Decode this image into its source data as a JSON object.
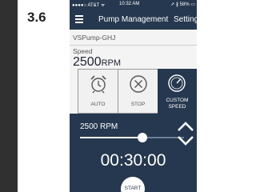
{
  "step": {
    "number": "3.6"
  },
  "status_bar": {
    "carrier": "●●●●○ AT&T ᯤ",
    "time": "10:32 AM",
    "battery": "➚ ∦ 58% ▭"
  },
  "nav": {
    "menu_icon": "hamburger-icon",
    "title": "Pump Management",
    "setting": "Setting"
  },
  "pump": {
    "name": "VSPump-GHJ"
  },
  "speed": {
    "label": "Speed",
    "value": "2500",
    "unit": "RPM"
  },
  "modes": [
    {
      "label": "AUTO",
      "icon": "alarm-clock-icon",
      "selected": false
    },
    {
      "label": "STOP",
      "icon": "stop-x-icon",
      "selected": false
    },
    {
      "label_line1": "CUSTOM",
      "label_line2": "SPEED",
      "icon": "gauge-icon",
      "selected": true
    }
  ],
  "custom": {
    "rpm_label": "2500 RPM",
    "slider_fraction": 0.6,
    "timer": "00:30:00",
    "start_label": "START",
    "up_icon": "chevron-up-icon",
    "down_icon": "chevron-down-icon"
  },
  "colors": {
    "nav_background": "#26384f",
    "panel_background": "#26384f",
    "mode_border": "#9a9a9a",
    "left_strip": "#303030"
  }
}
